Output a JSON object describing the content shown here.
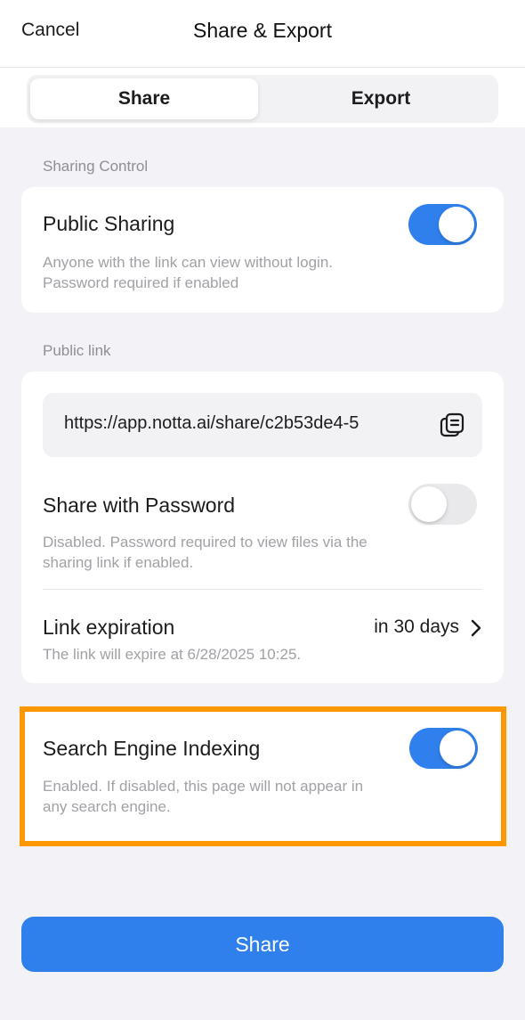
{
  "header": {
    "cancel_label": "Cancel",
    "title": "Share & Export"
  },
  "tabs": [
    {
      "label": "Share",
      "active": true
    },
    {
      "label": "Export",
      "active": false
    }
  ],
  "sharing_control": {
    "section_label": "Sharing Control",
    "public_sharing": {
      "title": "Public Sharing",
      "description": "Anyone with the link can view without login. Password required if enabled",
      "enabled": true
    }
  },
  "public_link": {
    "section_label": "Public link",
    "url": "https://app.notta.ai/share/c2b53de4-5",
    "share_with_password": {
      "title": "Share with Password",
      "description": "Disabled. Password required to view files via the sharing link if enabled.",
      "enabled": false
    },
    "link_expiration": {
      "title": "Link expiration",
      "value": "in 30 days",
      "description": "The link will expire at 6/28/2025 10:25."
    }
  },
  "search_engine_indexing": {
    "title": "Search Engine Indexing",
    "description": "Enabled. If disabled, this page will not appear in any search engine.",
    "enabled": true
  },
  "share_button_label": "Share",
  "colors": {
    "accent": "#2f80ed",
    "highlight": "#ff9800",
    "background": "#f2f2f7"
  },
  "icons": {
    "copy": "copy-icon",
    "chevron": "chevron-right-icon"
  }
}
